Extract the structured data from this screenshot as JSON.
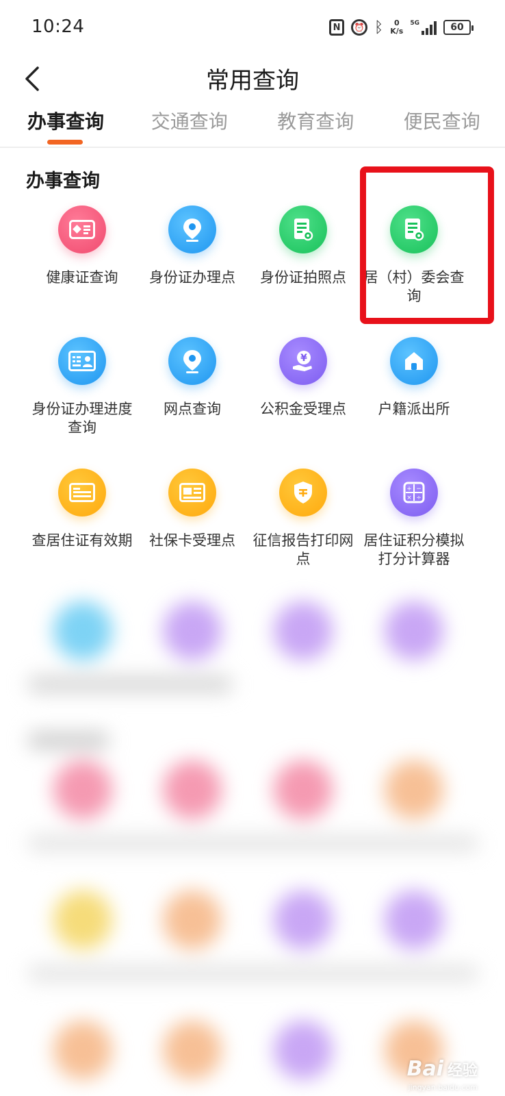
{
  "status_bar": {
    "time": "10:24",
    "nfc_icon": "N",
    "network_speed_value": "0",
    "network_speed_unit": "K/s",
    "network_type": "5G",
    "battery_level": "60"
  },
  "header": {
    "title": "常用查询",
    "back_icon": "chevron-left-icon"
  },
  "tabs": [
    {
      "label": "办事查询",
      "active": true
    },
    {
      "label": "交通查询",
      "active": false
    },
    {
      "label": "教育查询",
      "active": false
    },
    {
      "label": "便民查询",
      "active": false
    }
  ],
  "section": {
    "title": "办事查询",
    "items": [
      {
        "label": "健康证查询",
        "icon": "id-card-icon",
        "color": "#f04a6e"
      },
      {
        "label": "身份证办理点",
        "icon": "location-pin-icon",
        "color": "#1f96f0"
      },
      {
        "label": "身份证拍照点",
        "icon": "document-icon",
        "color": "#18c15a"
      },
      {
        "label": "居（村）委会查询",
        "icon": "document-icon",
        "color": "#18c15a",
        "highlighted": true
      },
      {
        "label": "身份证办理进度查询",
        "icon": "id-card-person-icon",
        "color": "#1f96f0"
      },
      {
        "label": "网点查询",
        "icon": "location-pin-icon",
        "color": "#1f96f0"
      },
      {
        "label": "公积金受理点",
        "icon": "yuan-hand-icon",
        "color": "#7d5cf0"
      },
      {
        "label": "户籍派出所",
        "icon": "home-icon",
        "color": "#1f96f0"
      },
      {
        "label": "查居住证有效期",
        "icon": "residence-card-icon",
        "color": "#ffa90d"
      },
      {
        "label": "社保卡受理点",
        "icon": "social-security-card-icon",
        "color": "#ffa90d"
      },
      {
        "label": "征信报告打印网点",
        "icon": "credit-shield-icon",
        "color": "#ffa90d"
      },
      {
        "label": "居住证积分模拟打分计算器",
        "icon": "calculator-icon",
        "color": "#7d5cf0"
      }
    ]
  },
  "watermark": {
    "logo": "Bai",
    "text": "经验",
    "url": "jingyan.baidu.com"
  },
  "colors": {
    "accent": "#f26522",
    "highlight": "#e8111a"
  }
}
